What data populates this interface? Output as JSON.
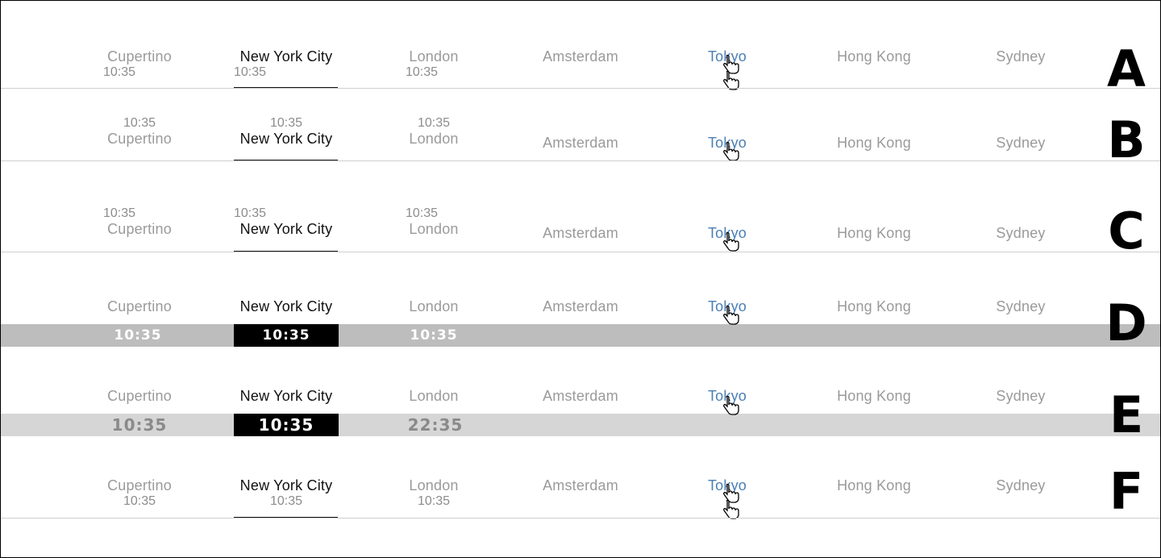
{
  "cities": [
    "Cupertino",
    "New York City",
    "London",
    "Amsterdam",
    "Tokyo",
    "Hong Kong",
    "Sydney"
  ],
  "variants": {
    "a": {
      "letter": "A",
      "times": [
        "10:35",
        "10:35",
        "10:35"
      ]
    },
    "b": {
      "letter": "B",
      "times": [
        "10:35",
        "10:35",
        "10:35"
      ]
    },
    "c": {
      "letter": "C",
      "times": [
        "10:35",
        "10:35",
        "10:35"
      ]
    },
    "d": {
      "letter": "D",
      "times": [
        "10:35",
        "10:35",
        "10:35"
      ]
    },
    "e": {
      "letter": "E",
      "times": [
        "10:35",
        "10:35",
        "22:35"
      ]
    },
    "f": {
      "letter": "F",
      "times": [
        "10:35",
        "10:35",
        "10:35"
      ]
    }
  },
  "colors": {
    "active": "#111111",
    "inactive": "#9a9a9a",
    "hover": "#4a7fb5",
    "band_d": "#bdbdbd",
    "band_e": "#d6d6d6"
  },
  "icons": {
    "cursor": "hand-pointer-icon"
  }
}
